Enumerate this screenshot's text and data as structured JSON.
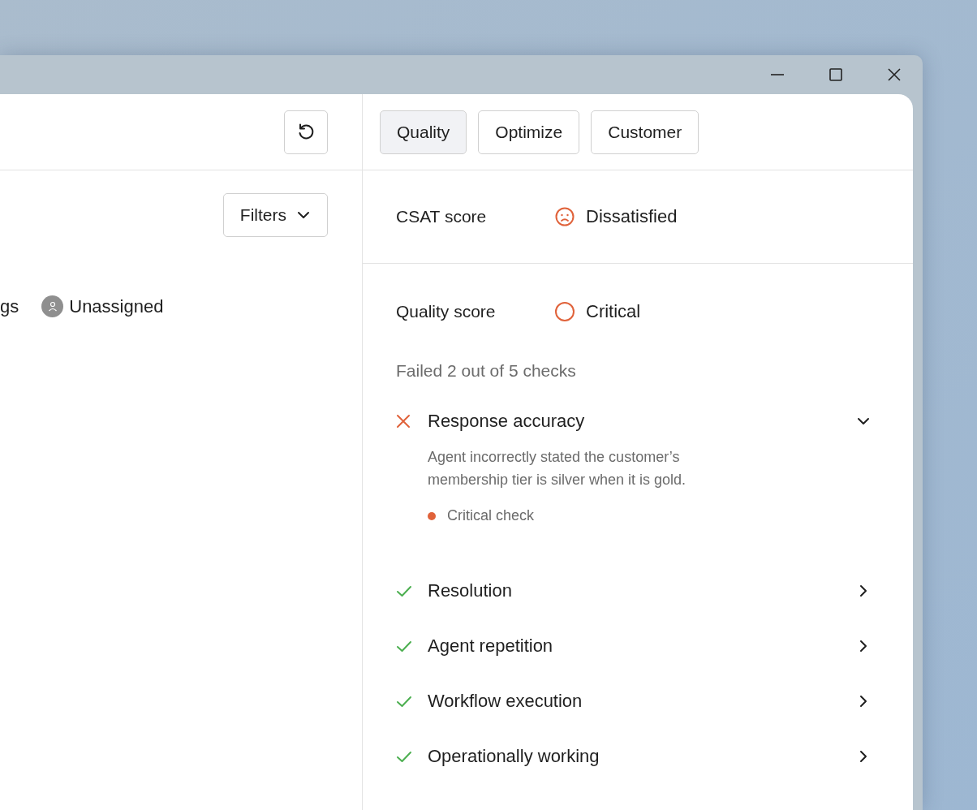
{
  "left_panel": {
    "filters_button": "Filters",
    "tags_text": "gs",
    "assignee": "Unassigned"
  },
  "tabs": [
    {
      "label": "Quality",
      "selected": true
    },
    {
      "label": "Optimize",
      "selected": false
    },
    {
      "label": "Customer",
      "selected": false
    }
  ],
  "csat": {
    "label": "CSAT score",
    "value": "Dissatisfied",
    "kind": "dissatisfied"
  },
  "quality": {
    "label": "Quality score",
    "value": "Critical",
    "kind": "critical",
    "summary": "Failed 2 out of 5 checks"
  },
  "checks": [
    {
      "name": "Response accuracy",
      "kind": "failed",
      "expanded": true,
      "description": "Agent incorrectly stated the customer’s membership tier is silver when it is gold.",
      "tag": {
        "label": "Critical check",
        "color": "#e0623a"
      }
    },
    {
      "name": "Resolution",
      "kind": "passed",
      "expanded": false
    },
    {
      "name": "Agent repetition",
      "kind": "passed",
      "expanded": false
    },
    {
      "name": "Workflow execution",
      "kind": "passed",
      "expanded": false
    },
    {
      "name": "Operationally working",
      "kind": "passed",
      "expanded": false
    }
  ]
}
